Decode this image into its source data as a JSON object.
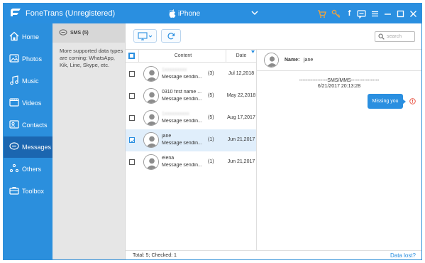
{
  "app": {
    "title": "FoneTrans (Unregistered)",
    "device": "iPhone"
  },
  "nav": {
    "items": [
      {
        "label": "Home",
        "icon": "home-icon"
      },
      {
        "label": "Photos",
        "icon": "photos-icon"
      },
      {
        "label": "Music",
        "icon": "music-icon"
      },
      {
        "label": "Videos",
        "icon": "videos-icon"
      },
      {
        "label": "Contacts",
        "icon": "contacts-icon"
      },
      {
        "label": "Messages",
        "icon": "messages-icon",
        "active": true
      },
      {
        "label": "Others",
        "icon": "others-icon"
      },
      {
        "label": "Toolbox",
        "icon": "toolbox-icon"
      }
    ]
  },
  "info": {
    "title": "SMS (5)",
    "text": "More supported data types are coming: WhatsApp, Kik, Line, Skype, etc."
  },
  "search": {
    "placeholder": "search"
  },
  "list": {
    "header": {
      "content": "Content",
      "date": "Date"
    },
    "rows": [
      {
        "name": "1xxxxxxxxx",
        "preview": "Message sendin...",
        "count": "(3)",
        "date": "Jul 12,2018",
        "checked": false,
        "blurred": true
      },
      {
        "name": "0310 first name ...",
        "preview": "Message sendin...",
        "count": "(5)",
        "date": "May 22,2018",
        "checked": false,
        "blurred": false
      },
      {
        "name": "1xxxxxxxxxx",
        "preview": "Message sendin...",
        "count": "(5)",
        "date": "Aug 17,2017",
        "checked": false,
        "blurred": true
      },
      {
        "name": "jane",
        "preview": "Message sendin...",
        "count": "(1)",
        "date": "Jun 21,2017",
        "checked": true,
        "blurred": false
      },
      {
        "name": "elena",
        "preview": "Message sendin...",
        "count": "(1)",
        "date": "Jun 21,2017",
        "checked": false,
        "blurred": false
      }
    ]
  },
  "conversation": {
    "name_label": "Name:",
    "name": "jane",
    "type_line": "-----------------SMS/MMS-----------------",
    "time": "6/21/2017 20:13:28",
    "message": "Missing you"
  },
  "status": {
    "summary": "Total: 5; Checked: 1",
    "data_lost": "Data lost?"
  },
  "colors": {
    "accent": "#2a8fe0",
    "nav_active": "#1b66b0",
    "warning": "#f3a33a",
    "alert": "#e74c3c"
  }
}
